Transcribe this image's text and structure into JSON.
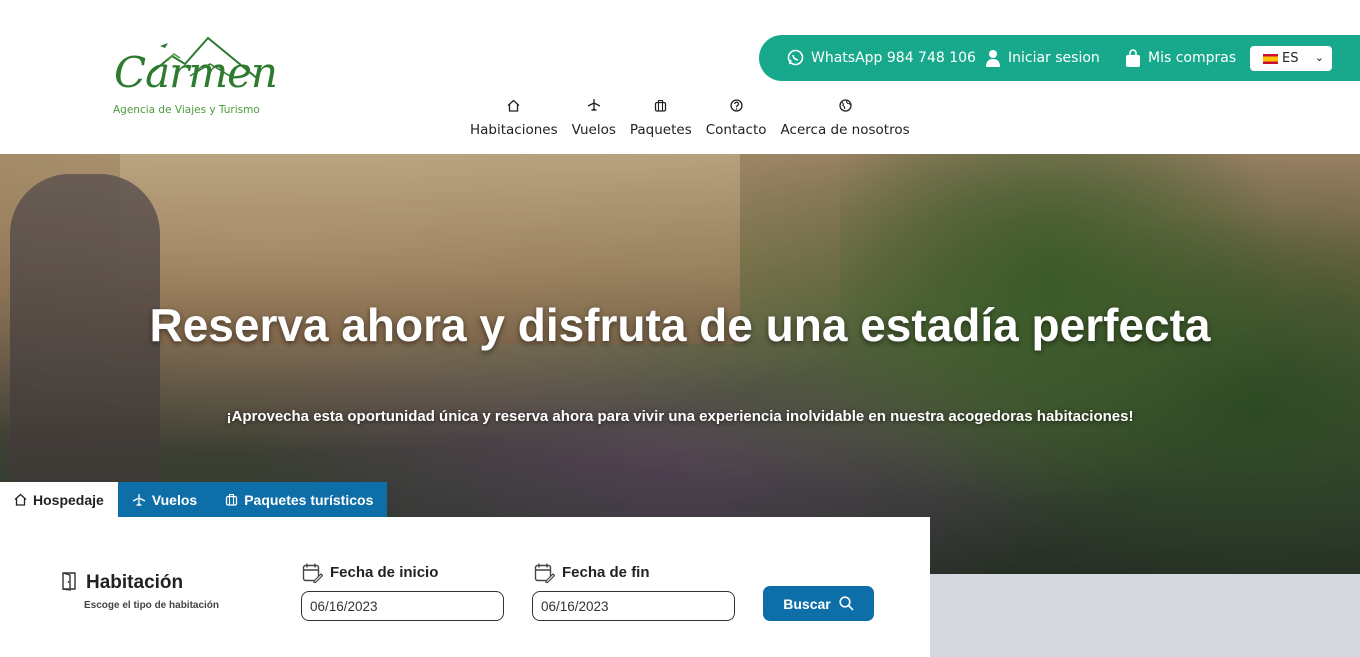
{
  "brand": {
    "name": "Carmen",
    "tagline": "Agencia de Viajes y Turismo",
    "primary_color": "#18a98c",
    "accent_color": "#0e6ea8",
    "logo_color": "#2e7a2f"
  },
  "topbar": {
    "whatsapp_label": "WhatsApp 984 748 106",
    "whatsapp_icon": "whatsapp-icon",
    "login_label": "Iniciar sesion",
    "login_icon": "user-icon",
    "purchases_label": "Mis compras",
    "purchases_icon": "shopping-bag-icon",
    "language": "ES",
    "language_flag": "spain-flag-icon"
  },
  "nav": {
    "items": [
      {
        "label": "Habitaciones",
        "icon": "home-icon"
      },
      {
        "label": "Vuelos",
        "icon": "airplane-icon"
      },
      {
        "label": "Paquetes",
        "icon": "suitcase-icon"
      },
      {
        "label": "Contacto",
        "icon": "question-circle-icon"
      },
      {
        "label": "Acerca de nosotros",
        "icon": "globe-icon"
      }
    ]
  },
  "hero": {
    "title": "Reserva ahora y disfruta de una estadía perfecta",
    "subtitle": "¡Aprovecha esta oportunidad única y reserva ahora para vivir una experiencia inolvidable en nuestra acogedoras habitaciones!"
  },
  "tabs": [
    {
      "label": "Hospedaje",
      "icon": "home-icon",
      "active": true
    },
    {
      "label": "Vuelos",
      "icon": "airplane-icon",
      "active": false
    },
    {
      "label": "Paquetes turísticos",
      "icon": "suitcase-icon",
      "active": false
    }
  ],
  "search": {
    "room_title": "Habitación",
    "room_subtitle": "Escoge el tipo de habitación",
    "start_label": "Fecha de inicio",
    "start_value": "06/16/2023",
    "end_label": "Fecha de fin",
    "end_value": "06/16/2023",
    "button_label": "Buscar"
  }
}
